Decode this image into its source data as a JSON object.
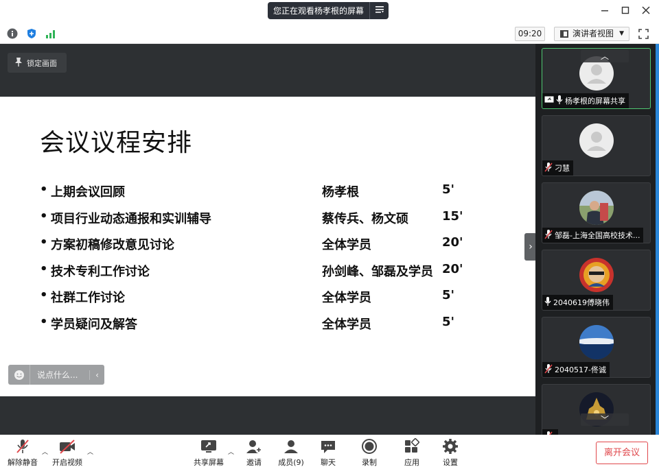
{
  "titlebar": {
    "share_banner": "您正在观看杨孝根的屏幕",
    "banner_menu_icon": "menu-lines-icon",
    "window_controls": [
      "minimize",
      "maximize",
      "close"
    ]
  },
  "infobar": {
    "time": "09:20",
    "view_mode": "演讲者视图",
    "icons": [
      "info-icon",
      "shield-icon",
      "signal-icon",
      "fullscreen-icon"
    ],
    "colors": {
      "shield": "#1f7fe0",
      "signal": "#2fb457"
    }
  },
  "main": {
    "lock_button": "锁定画面",
    "chat_placeholder": "说点什么...",
    "slide": {
      "title": "会议议程安排",
      "bullet": "•",
      "agenda": [
        {
          "topic": "上期会议回顾",
          "speaker": "杨孝根",
          "duration": "5'"
        },
        {
          "topic": "项目行业动态通报和实训辅导",
          "speaker": "蔡传兵、杨文硕",
          "duration": "15'"
        },
        {
          "topic": "方案初稿修改意见讨论",
          "speaker": "全体学员",
          "duration": "20'"
        },
        {
          "topic": "技术专利工作讨论",
          "speaker": "孙剑峰、邹磊及学员",
          "duration": "20'"
        },
        {
          "topic": "社群工作讨论",
          "speaker": "全体学员",
          "duration": "5'"
        },
        {
          "topic": "学员疑问及解答",
          "speaker": "全体学员",
          "duration": "5'"
        }
      ]
    }
  },
  "gallery": {
    "participants": [
      {
        "name": "杨孝根的屏幕共享",
        "audio": "unmuted",
        "avatar": "default",
        "sharing": true
      },
      {
        "name": "刁慧",
        "audio": "muted",
        "avatar": "default"
      },
      {
        "name": "邹磊-上海全国高校技术...",
        "audio": "muted",
        "avatar": "photo"
      },
      {
        "name": "2040619傅晓伟",
        "audio": "unmuted",
        "avatar": "photo"
      },
      {
        "name": "2040517-佟诚",
        "audio": "muted",
        "avatar": "photo"
      },
      {
        "name": "",
        "audio": "muted",
        "avatar": "photo"
      }
    ]
  },
  "toolbar": {
    "unmute": "解除静音",
    "start_video": "开启视频",
    "share_screen": "共享屏幕",
    "invite": "邀请",
    "participants": "成员(9)",
    "chat": "聊天",
    "record": "录制",
    "apps": "应用",
    "settings": "设置",
    "leave": "离开会议",
    "colors": {
      "leave": "#e0474b",
      "muted": "#e0474b"
    }
  }
}
